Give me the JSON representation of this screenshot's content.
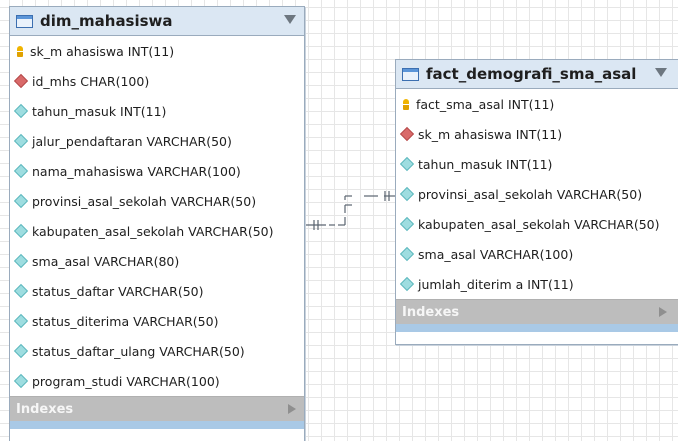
{
  "entities": {
    "dim_mahasiswa": {
      "title": "dim_mahasiswa",
      "columns": [
        {
          "text": "sk_m ahasiswa INT(11)",
          "kind": "key"
        },
        {
          "text": "id_mhs CHAR(100)",
          "kind": "fk"
        },
        {
          "text": "tahun_masuk INT(11)",
          "kind": "col"
        },
        {
          "text": "jalur_pendaftaran VARCHAR(50)",
          "kind": "col"
        },
        {
          "text": "nama_mahasiswa VARCHAR(100)",
          "kind": "col"
        },
        {
          "text": "provinsi_asal_sekolah VARCHAR(50)",
          "kind": "col"
        },
        {
          "text": "kabupaten_asal_sekolah VARCHAR(50)",
          "kind": "col"
        },
        {
          "text": "sma_asal VARCHAR(80)",
          "kind": "col"
        },
        {
          "text": "status_daftar VARCHAR(50)",
          "kind": "col"
        },
        {
          "text": "status_diterima VARCHAR(50)",
          "kind": "col"
        },
        {
          "text": "status_daftar_ulang VARCHAR(50)",
          "kind": "col"
        },
        {
          "text": "program_studi VARCHAR(100)",
          "kind": "col"
        }
      ],
      "indexes_label": "Indexes"
    },
    "fact_demografi_sma_asal": {
      "title": "fact_demografi_sma_asal",
      "columns": [
        {
          "text": "fact_sma_asal INT(11)",
          "kind": "key"
        },
        {
          "text": "sk_m ahasiswa INT(11)",
          "kind": "fk"
        },
        {
          "text": "tahun_masuk INT(11)",
          "kind": "col"
        },
        {
          "text": "provinsi_asal_sekolah VARCHAR(50)",
          "kind": "col"
        },
        {
          "text": "kabupaten_asal_sekolah VARCHAR(50)",
          "kind": "col"
        },
        {
          "text": "sma_asal VARCHAR(100)",
          "kind": "col"
        },
        {
          "text": "jumlah_diterim a INT(11)",
          "kind": "col"
        }
      ],
      "indexes_label": "Indexes"
    }
  },
  "icons": {
    "key": "primary-key-icon",
    "fk": "foreign-key-icon",
    "col": "column-icon"
  },
  "colors": {
    "header": "#dbe7f3",
    "footer": "#a9c9e6",
    "indexes": "#bdbdbd",
    "grid": "#e6e6e6"
  }
}
